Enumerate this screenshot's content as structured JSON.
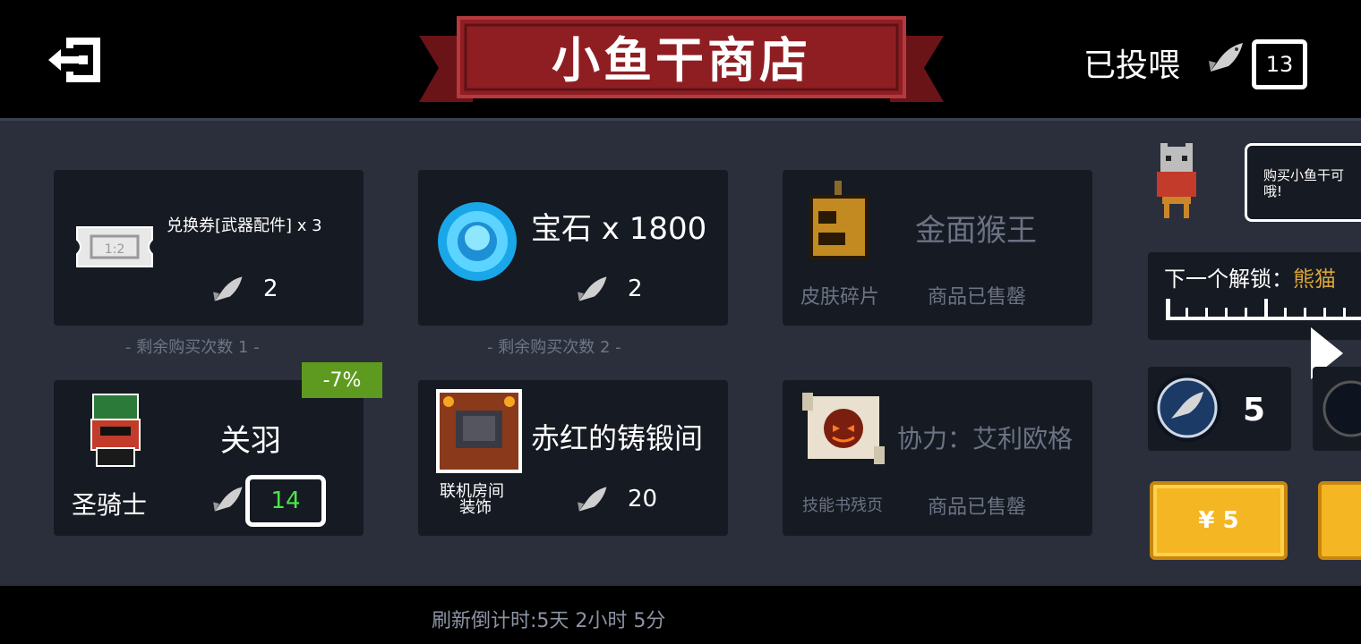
{
  "header": {
    "title": "小鱼干商店",
    "fed_label": "已投喂",
    "fed_count": "13"
  },
  "shop": {
    "items": [
      {
        "name": "兑换券[武器配件] x 3",
        "price": "2",
        "remaining": "- 剩余购买次数 1 -"
      },
      {
        "name": "宝石 x 1800",
        "price": "2",
        "remaining": "- 剩余购买次数 2 -"
      },
      {
        "name": "金面猴王",
        "category": "皮肤碎片",
        "status": "商品已售罄"
      },
      {
        "name": "关羽",
        "category": "圣骑士",
        "price": "14",
        "discount": "-7%"
      },
      {
        "name": "赤红的铸锻间",
        "category": "联机房间装饰",
        "category_line1": "联机房间",
        "category_line2": "装饰",
        "price": "20"
      },
      {
        "name": "协力：艾利欧格",
        "category": "技能书残页",
        "status": "商品已售罄"
      }
    ]
  },
  "side": {
    "speech": "购买小鱼干可哦!",
    "speech_line1": "购买小鱼干可",
    "speech_line2": "哦!",
    "next_unlock_label": "下一个解锁：",
    "next_unlock_name": "熊猫",
    "coin_count": "5",
    "buy_label": "¥ 5"
  },
  "footer": {
    "refresh": "刷新倒计时:5天 2小时 5分"
  },
  "colors": {
    "panel": "#2a2f3b",
    "card": "#161a22",
    "banner": "#8f1e23",
    "discount": "#5e9a1f",
    "buy": "#f5b623",
    "price_highlight": "#4ce34c"
  }
}
